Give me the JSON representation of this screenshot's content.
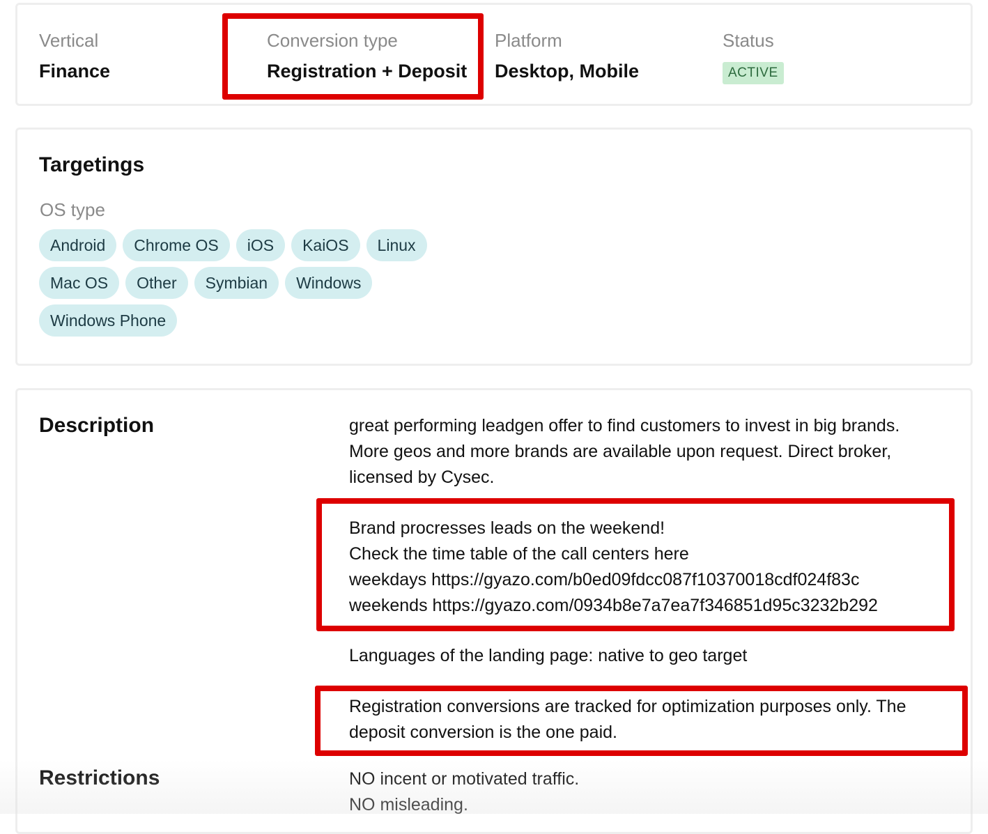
{
  "summary": {
    "vertical": {
      "label": "Vertical",
      "value": "Finance"
    },
    "conversion_type": {
      "label": "Conversion type",
      "value": "Registration + Deposit"
    },
    "platform": {
      "label": "Platform",
      "value": "Desktop, Mobile"
    },
    "status": {
      "label": "Status",
      "value": "ACTIVE"
    }
  },
  "targetings": {
    "title": "Targetings",
    "os_type_label": "OS type",
    "os_types": [
      "Android",
      "Chrome OS",
      "iOS",
      "KaiOS",
      "Linux",
      "Mac OS",
      "Other",
      "Symbian",
      "Windows",
      "Windows Phone"
    ]
  },
  "description": {
    "title": "Description",
    "para1": [
      "great performing leadgen offer to find customers to invest in big brands.",
      "More geos and more brands are available upon request. Direct broker,",
      "licensed by Cysec."
    ],
    "para2": [
      "Brand procresses leads on the weekend!",
      "Check the time table of the call centers here",
      "weekdays https://gyazo.com/b0ed09fdcc087f10370018cdf024f83c",
      "weekends https://gyazo.com/0934b8e7a7ea7f346851d95c3232b292"
    ],
    "para3": [
      "Languages of the landing page: native to geo target"
    ],
    "para4": [
      "Registration conversions are tracked for optimization purposes only. The",
      "deposit conversion is the one paid."
    ]
  },
  "restrictions": {
    "title": "Restrictions",
    "lines": [
      "NO incent or motivated traffic.",
      "NO misleading."
    ]
  },
  "colors": {
    "highlight": "#dd0000",
    "chip_bg": "#d4eef0",
    "status_bg": "#c9ecd1"
  }
}
